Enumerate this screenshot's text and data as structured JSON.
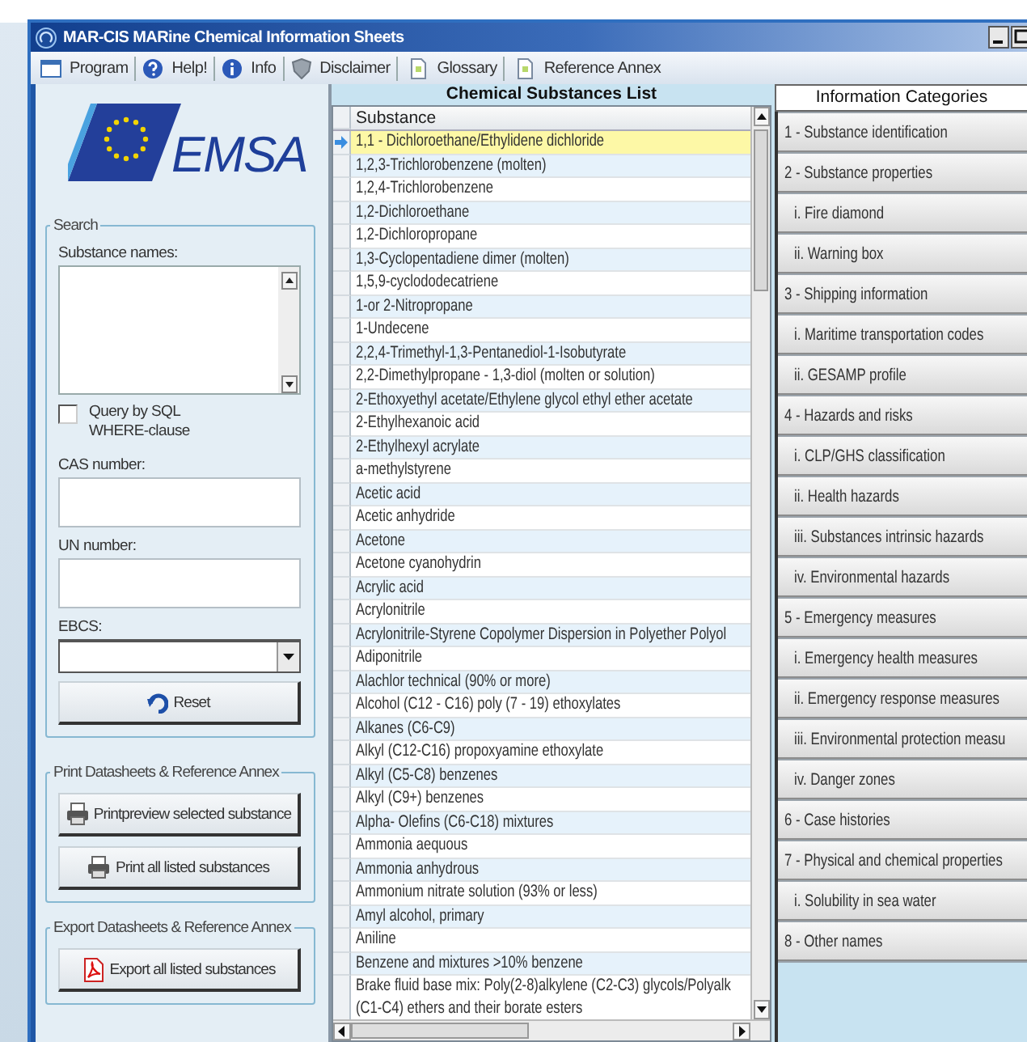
{
  "window": {
    "title": "MAR-CIS MARine Chemical Information Sheets"
  },
  "toolbar": [
    {
      "label": "Program",
      "kind": "window"
    },
    {
      "label": "Help!",
      "kind": "help"
    },
    {
      "label": "Info",
      "kind": "info"
    },
    {
      "label": "Disclaimer",
      "kind": "shield"
    },
    {
      "label": "Glossary",
      "kind": "document"
    },
    {
      "label": "Reference Annex",
      "kind": "document"
    }
  ],
  "logo": {
    "text": "EMSA"
  },
  "search": {
    "title": "Search",
    "fields": [
      {
        "kind": "textarea",
        "label": "Substance names:"
      },
      {
        "kind": "checkbox",
        "label": "Query by SQL WHERE-clause",
        "checked": false
      },
      {
        "kind": "text",
        "label": "CAS number:"
      },
      {
        "kind": "text",
        "label": "UN number:"
      },
      {
        "kind": "dropdown",
        "label": "EBCS:"
      }
    ],
    "reset_button": "Reset"
  },
  "print_group": {
    "title": "Print Datasheets & Reference Annex",
    "buttons": [
      "Printpreview selected substance",
      "Print all listed substances"
    ]
  },
  "export_group": {
    "title": "Export Datasheets & Reference Annex",
    "buttons": [
      "Export all listed substances"
    ]
  },
  "substances": {
    "title": "Chemical Substances List",
    "column": "Substance",
    "rows": [
      {
        "name": "1,1 - Dichloroethane/Ethylidene dichloride",
        "selected": true
      },
      {
        "name": "1,2,3-Trichlorobenzene (molten)",
        "selected": false
      },
      {
        "name": "1,2,4-Trichlorobenzene",
        "selected": false
      },
      {
        "name": "1,2-Dichloroethane",
        "selected": false
      },
      {
        "name": "1,2-Dichloropropane",
        "selected": false
      },
      {
        "name": "1,3-Cyclopentadiene dimer (molten)",
        "selected": false
      },
      {
        "name": "1,5,9-cyclododecatriene",
        "selected": false
      },
      {
        "name": "1-or 2-Nitropropane",
        "selected": false
      },
      {
        "name": "1-Undecene",
        "selected": false
      },
      {
        "name": "2,2,4-Trimethyl-1,3-Pentanediol-1-Isobutyrate",
        "selected": false
      },
      {
        "name": "2,2-Dimethylpropane - 1,3-diol (molten or solution)",
        "selected": false
      },
      {
        "name": "2-Ethoxyethyl acetate/Ethylene glycol ethyl ether acetate",
        "selected": false
      },
      {
        "name": "2-Ethylhexanoic acid",
        "selected": false
      },
      {
        "name": "2-Ethylhexyl acrylate",
        "selected": false
      },
      {
        "name": "a-methylstyrene",
        "selected": false
      },
      {
        "name": "Acetic acid",
        "selected": false
      },
      {
        "name": "Acetic anhydride",
        "selected": false
      },
      {
        "name": "Acetone",
        "selected": false
      },
      {
        "name": "Acetone cyanohydrin",
        "selected": false
      },
      {
        "name": "Acrylic acid",
        "selected": false
      },
      {
        "name": "Acrylonitrile",
        "selected": false
      },
      {
        "name": "Acrylonitrile-Styrene Copolymer Dispersion in Polyether Polyol",
        "selected": false
      },
      {
        "name": "Adiponitrile",
        "selected": false
      },
      {
        "name": "Alachlor technical (90% or more)",
        "selected": false
      },
      {
        "name": "Alcohol (C12 - C16) poly (7 - 19) ethoxylates",
        "selected": false
      },
      {
        "name": "Alkanes (C6-C9)",
        "selected": false
      },
      {
        "name": "Alkyl (C12-C16) propoxyamine ethoxylate",
        "selected": false
      },
      {
        "name": "Alkyl (C5-C8) benzenes",
        "selected": false
      },
      {
        "name": "Alkyl (C9+) benzenes",
        "selected": false
      },
      {
        "name": "Alpha- Olefins (C6-C18) mixtures",
        "selected": false
      },
      {
        "name": "Ammonia aequous",
        "selected": false
      },
      {
        "name": "Ammonia anhydrous",
        "selected": false
      },
      {
        "name": "Ammonium nitrate solution (93% or less)",
        "selected": false
      },
      {
        "name": "Amyl alcohol, primary",
        "selected": false
      },
      {
        "name": "Aniline",
        "selected": false
      },
      {
        "name": "Benzene and mixtures >10% benzene",
        "selected": false
      },
      {
        "name": "Brake fluid base mix: Poly(2-8)alkylene (C2-C3) glycols/Polyalk\n(C1-C4) ethers and their borate esters",
        "selected": false
      }
    ]
  },
  "categories": {
    "title": "Information Categories",
    "items": [
      {
        "label": "1 - Substance identification"
      },
      {
        "label": "2 - Substance properties",
        "children": [
          {
            "label": "i. Fire diamond"
          },
          {
            "label": "ii. Warning box"
          }
        ]
      },
      {
        "label": "3 - Shipping information",
        "children": [
          {
            "label": "i. Maritime transportation codes"
          },
          {
            "label": "ii. GESAMP profile"
          }
        ]
      },
      {
        "label": "4 - Hazards and risks",
        "children": [
          {
            "label": "i. CLP/GHS classification"
          },
          {
            "label": "ii. Health hazards"
          },
          {
            "label": "iii. Substances intrinsic hazards"
          },
          {
            "label": "iv. Environmental hazards"
          }
        ]
      },
      {
        "label": "5 - Emergency measures",
        "children": [
          {
            "label": "i. Emergency health measures"
          },
          {
            "label": "ii. Emergency response measures"
          },
          {
            "label": "iii. Environmental protection measu"
          },
          {
            "label": "iv. Danger zones"
          }
        ]
      },
      {
        "label": "6 - Case histories"
      },
      {
        "label": "7 - Physical and chemical properties",
        "children": [
          {
            "label": "i. Solubility in sea water"
          }
        ]
      },
      {
        "label": "8 - Other names"
      }
    ]
  }
}
